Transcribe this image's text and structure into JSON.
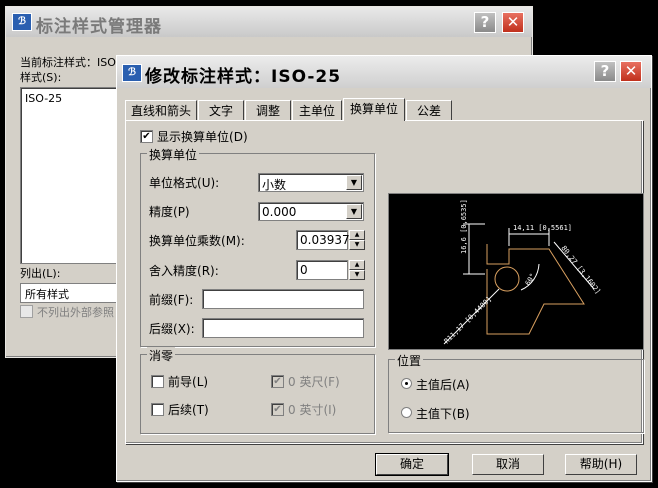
{
  "bg_window": {
    "title": "标注样式管理器",
    "current_style_label": "当前标注样式：ISO",
    "styles_label": "样式(S):",
    "styles_label_key": "S",
    "styles": [
      "ISO-25"
    ],
    "list_label": "列出(L):",
    "list_value": "所有样式",
    "exclude_external_label": "不列出外部参照"
  },
  "dialog": {
    "title": "修改标注样式：ISO-25",
    "tabs": [
      {
        "label": "直线和箭头"
      },
      {
        "label": "文字"
      },
      {
        "label": "调整"
      },
      {
        "label": "主单位"
      },
      {
        "label": "换算单位"
      },
      {
        "label": "公差"
      }
    ],
    "active_tab": "换算单位",
    "show_alt_units": {
      "label": "显示换算单位",
      "key": "(D)",
      "checked": true
    },
    "alt_units_group": {
      "title": "换算单位",
      "unit_format": {
        "label": "单位格式",
        "key": "(U):",
        "value": "小数"
      },
      "precision": {
        "label": "精度",
        "key": "(P)",
        "value": "0.000"
      },
      "multiplier": {
        "label": "换算单位乘数",
        "key": "(M):",
        "value": "0.039370"
      },
      "round_off": {
        "label": "舍入精度",
        "key": "(R):",
        "value": "0"
      },
      "prefix": {
        "label": "前缀",
        "key": "(F):",
        "value": ""
      },
      "suffix": {
        "label": "后缀",
        "key": "(X):",
        "value": ""
      }
    },
    "zero_suppression": {
      "title": "消零",
      "leading": {
        "label": "前导",
        "key": "(L)",
        "checked": false
      },
      "trailing": {
        "label": "后续",
        "key": "(T)",
        "checked": false
      },
      "feet": {
        "label": "0 英尺",
        "key": "(F)",
        "checked": true,
        "enabled": false
      },
      "inches": {
        "label": "0 英寸",
        "key": "(I)",
        "checked": true,
        "enabled": false
      }
    },
    "placement": {
      "title": "位置",
      "after_primary": {
        "label": "主值后",
        "key": "(A)",
        "selected": true
      },
      "below_primary": {
        "label": "主值下",
        "key": "(B)",
        "selected": false
      }
    },
    "preview_labels": {
      "top_dim": "14,11 [0,5561]",
      "left_dim": "16,6 [0,6535]",
      "right_dim": "R11,17 [0,4400]",
      "diag_dim": "80,27 [3,1602]",
      "angle": "60°"
    },
    "buttons": {
      "ok": "确定",
      "cancel": "取消",
      "help": "帮助(H)"
    }
  },
  "colors": {
    "dim_lines": "#ffffff",
    "geometry": "#d9a060",
    "preview_bg": "#000000",
    "close_button": "#c0301c"
  }
}
